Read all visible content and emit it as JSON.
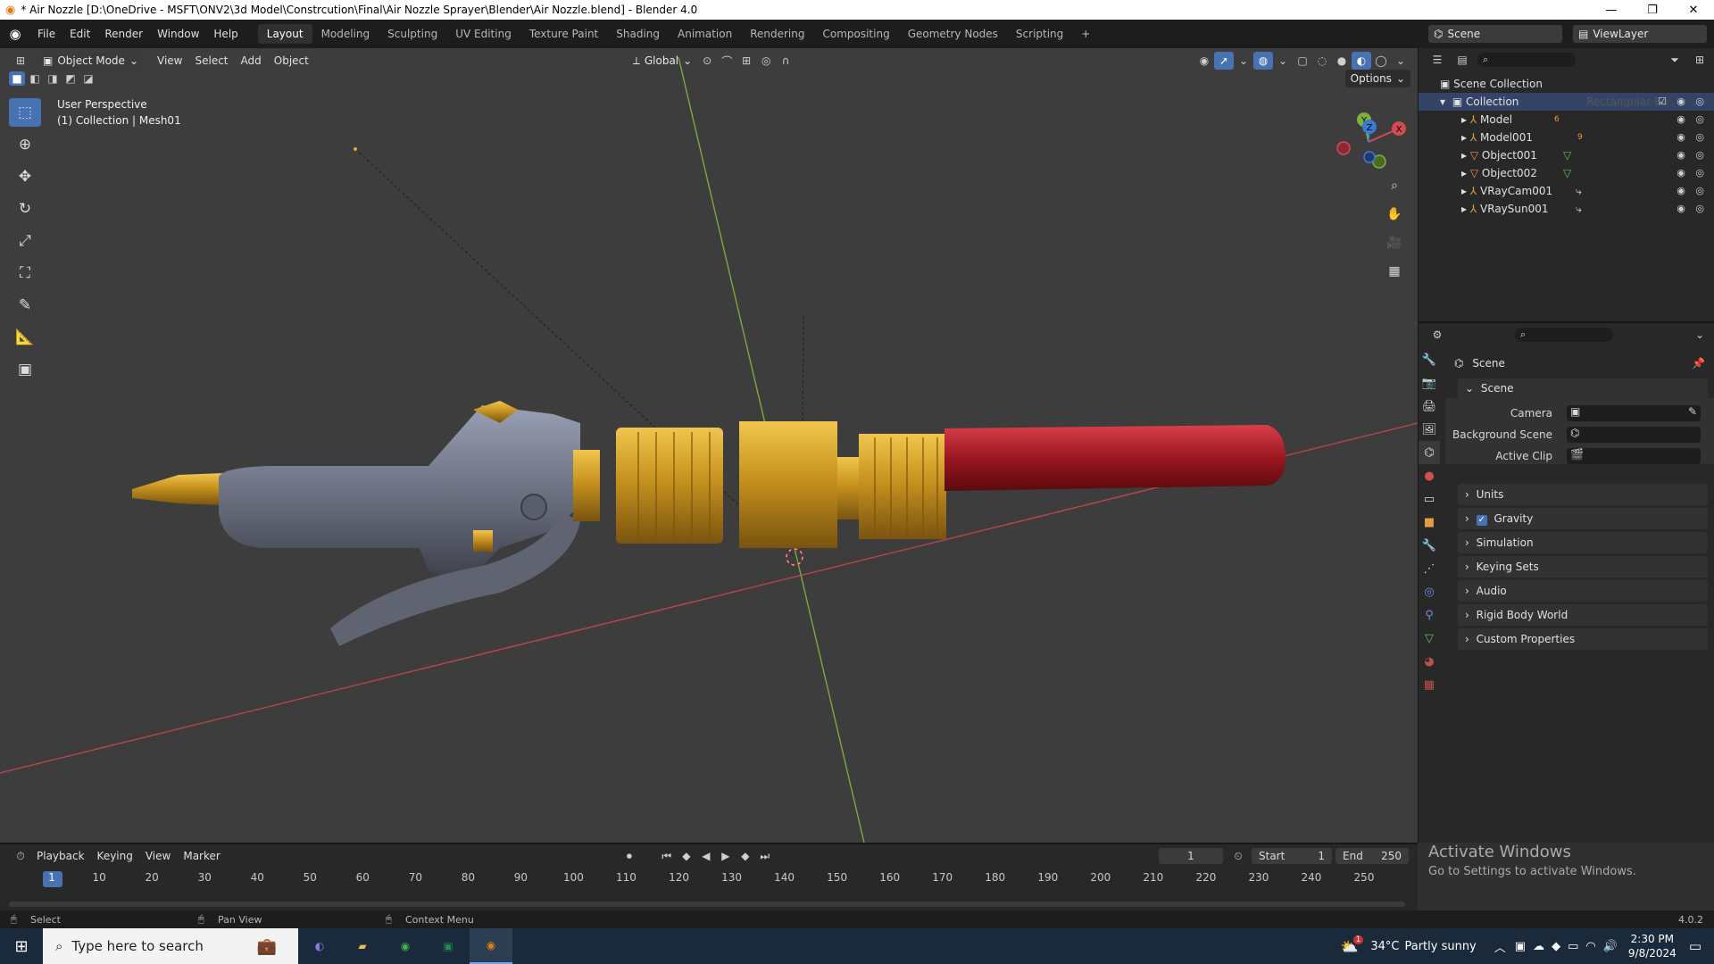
{
  "window": {
    "title": "* Air Nozzle [D:\\OneDrive - MSFT\\ONV2\\3d Model\\Constrcution\\Final\\Air Nozzle Sprayer\\Blender\\Air Nozzle.blend] - Blender 4.0",
    "minimize": "—",
    "maximize": "❐",
    "close": "✕"
  },
  "menus": [
    "File",
    "Edit",
    "Render",
    "Window",
    "Help"
  ],
  "workspaces": [
    "Layout",
    "Modeling",
    "Sculpting",
    "UV Editing",
    "Texture Paint",
    "Shading",
    "Animation",
    "Rendering",
    "Compositing",
    "Geometry Nodes",
    "Scripting"
  ],
  "add_workspace": "+",
  "scene_field": "Scene",
  "viewlayer_field": "ViewLayer",
  "viewport": {
    "mode": "Object Mode",
    "menus": [
      "View",
      "Select",
      "Add",
      "Object"
    ],
    "orientation": "Global",
    "options": "Options",
    "overlay_line1": "User Perspective",
    "overlay_line2": "(1) Collection | Mesh01",
    "gizmo": {
      "x": "X",
      "y": "Y",
      "z": "Z"
    }
  },
  "outliner": {
    "root": "Scene Collection",
    "collection": "Collection",
    "ghost_label": "Rectangular Ba",
    "items": [
      {
        "name": "Model",
        "badge": "6"
      },
      {
        "name": "Model001",
        "badge": "9"
      },
      {
        "name": "Object001",
        "badge": ""
      },
      {
        "name": "Object002",
        "badge": ""
      },
      {
        "name": "VRayCam001",
        "badge": ""
      },
      {
        "name": "VRaySun001",
        "badge": ""
      }
    ]
  },
  "properties": {
    "context": "Scene",
    "section": "Scene",
    "fields": [
      {
        "label": "Camera"
      },
      {
        "label": "Background Scene"
      },
      {
        "label": "Active Clip"
      }
    ],
    "panels": [
      "Units",
      "Gravity",
      "Simulation",
      "Keying Sets",
      "Audio",
      "Rigid Body World",
      "Custom Properties"
    ],
    "gravity_checked": true
  },
  "timeline": {
    "menus": [
      "Playback",
      "Keying",
      "View",
      "Marker"
    ],
    "current_frame": "1",
    "start_label": "Start",
    "start": "1",
    "end_label": "End",
    "end": "250",
    "ticks": [
      "1",
      "10",
      "20",
      "30",
      "40",
      "50",
      "60",
      "70",
      "80",
      "90",
      "100",
      "110",
      "120",
      "130",
      "140",
      "150",
      "160",
      "170",
      "180",
      "190",
      "200",
      "210",
      "220",
      "230",
      "240",
      "250"
    ]
  },
  "statusbar": {
    "select": "Select",
    "pan": "Pan View",
    "context": "Context Menu",
    "version": "4.0.2"
  },
  "activation": {
    "line1": "Activate Windows",
    "line2": "Go to Settings to activate Windows."
  },
  "taskbar": {
    "search_placeholder": "Type here to search",
    "weather_temp": "34°C",
    "weather_text": "Partly sunny",
    "weather_badge": "1",
    "time": "2:30 PM",
    "date": "9/8/2024"
  }
}
